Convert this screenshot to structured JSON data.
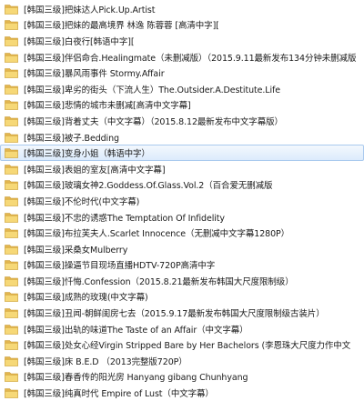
{
  "colors": {
    "folder_back": "#e2b54e",
    "folder_front": "#f6d877",
    "selection_border": "#a9c9ee"
  },
  "icon": "folder-icon",
  "selected_index": 9,
  "items": [
    "[韩国三级]把妹达人Pick.Up.Artist",
    "[韩国三级]把妹的最高境界 林逸 陈蓉蓉 [高清中字][",
    "[韩国三级]白夜行[韩语中字][",
    "[韩国三级]伴侣命合.Healingmate（未删减版）（2015.9.11最新发布134分钟未删减版",
    "[韩国三级]暴风雨事件 Stormy.Affair",
    "[韩国三级]卑劣的街头（下流人生）The.Outsider.A.Destitute.Life",
    "[韩国三级]悲情的城市未删减[高清中文字幕]",
    "[韩国三级]背着丈夫（中文字幕）（2015.8.12最新发布中文字幕版）",
    "[韩国三级]被子.Bedding",
    "[韩国三级]变身小姐（韩语中字）",
    "[韩国三级]表姐的室友[高清中文字幕]",
    "[韩国三级]玻璃女神2.Goddess.Of.Glass.Vol.2（百合爱无删减版",
    "[韩国三级]不伦时代(中文字幕)",
    "[韩国三级]不忠的诱惑The Temptation Of Infidelity",
    "[韩国三级]布拉芙夫人.Scarlet Innocence（无删减中文字幕1280P）",
    "[韩国三级]采桑女Mulberry",
    "[韩国三级]操逼节目现场直播HDTV-720P高清中字",
    "[韩国三级]忏悔.Confession（2015.8.21最新发布韩国大尺度限制级）",
    "[韩国三级]成熟的玫瑰(中文字幕)",
    "[韩国三级]丑闻-朝鲜闺房七去（2015.9.17最新发布韩国大尺度限制级古装片）",
    "[韩国三级]出轨的味道The Taste of an Affair（中文字幕）",
    "[韩国三级]处女心经Virgin Stripped Bare by Her Bachelors (李恩珠大尺度力作中文",
    "[韩国三级]床 B.E.D （2013完整版720P）",
    "[韩国三级]春香传的阳光房 Hanyang gibang Chunhyang",
    "[韩国三级]纯真时代 Empire of Lust（中文字幕）"
  ]
}
